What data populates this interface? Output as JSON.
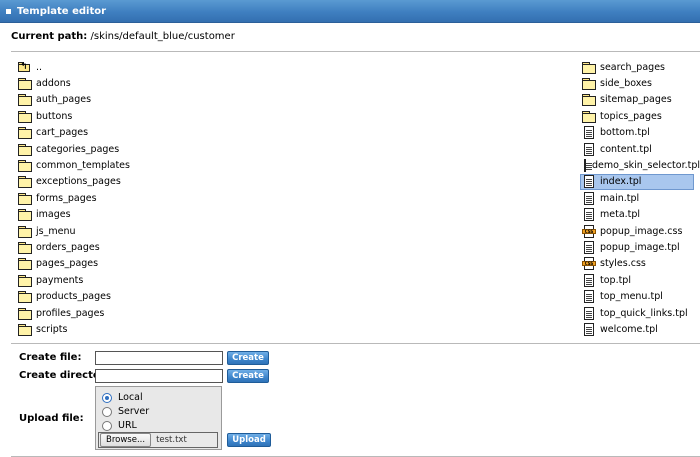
{
  "window": {
    "title": "Template editor"
  },
  "path": {
    "label": "Current path:",
    "value": "/skins/default_blue/customer"
  },
  "left_items": [
    {
      "name": "..",
      "type": "up"
    },
    {
      "name": "addons",
      "type": "folder"
    },
    {
      "name": "auth_pages",
      "type": "folder"
    },
    {
      "name": "buttons",
      "type": "folder"
    },
    {
      "name": "cart_pages",
      "type": "folder"
    },
    {
      "name": "categories_pages",
      "type": "folder"
    },
    {
      "name": "common_templates",
      "type": "folder"
    },
    {
      "name": "exceptions_pages",
      "type": "folder"
    },
    {
      "name": "forms_pages",
      "type": "folder"
    },
    {
      "name": "images",
      "type": "folder"
    },
    {
      "name": "js_menu",
      "type": "folder"
    },
    {
      "name": "orders_pages",
      "type": "folder"
    },
    {
      "name": "pages_pages",
      "type": "folder"
    },
    {
      "name": "payments",
      "type": "folder"
    },
    {
      "name": "products_pages",
      "type": "folder"
    },
    {
      "name": "profiles_pages",
      "type": "folder"
    },
    {
      "name": "scripts",
      "type": "folder"
    }
  ],
  "right_items": [
    {
      "name": "search_pages",
      "type": "folder"
    },
    {
      "name": "side_boxes",
      "type": "folder"
    },
    {
      "name": "sitemap_pages",
      "type": "folder"
    },
    {
      "name": "topics_pages",
      "type": "folder"
    },
    {
      "name": "bottom.tpl",
      "type": "file"
    },
    {
      "name": "content.tpl",
      "type": "file"
    },
    {
      "name": "demo_skin_selector.tpl",
      "type": "file"
    },
    {
      "name": "index.tpl",
      "type": "file",
      "selected": true
    },
    {
      "name": "main.tpl",
      "type": "file"
    },
    {
      "name": "meta.tpl",
      "type": "file"
    },
    {
      "name": "popup_image.css",
      "type": "css"
    },
    {
      "name": "popup_image.tpl",
      "type": "file"
    },
    {
      "name": "styles.css",
      "type": "css"
    },
    {
      "name": "top.tpl",
      "type": "file"
    },
    {
      "name": "top_menu.tpl",
      "type": "file"
    },
    {
      "name": "top_quick_links.tpl",
      "type": "file"
    },
    {
      "name": "welcome.tpl",
      "type": "file"
    }
  ],
  "create_file": {
    "label": "Create file:",
    "value": "",
    "button": "Create"
  },
  "create_directory": {
    "label": "Create directory:",
    "value": "",
    "button": "Create"
  },
  "upload": {
    "label": "Upload file:",
    "options": [
      {
        "label": "Local",
        "checked": true
      },
      {
        "label": "Server",
        "checked": false
      },
      {
        "label": "URL",
        "checked": false
      }
    ],
    "browse_label": "Browse...",
    "file_name": "test.txt",
    "button": "Upload"
  },
  "colors": {
    "header": "#3f7fc0",
    "button": "#3d85cc",
    "selection": "#a9c7ee"
  },
  "icons": {
    "folder": "folder-icon",
    "parent": "folder-up-icon",
    "template": "file-icon",
    "stylesheet": "css-file-icon"
  }
}
